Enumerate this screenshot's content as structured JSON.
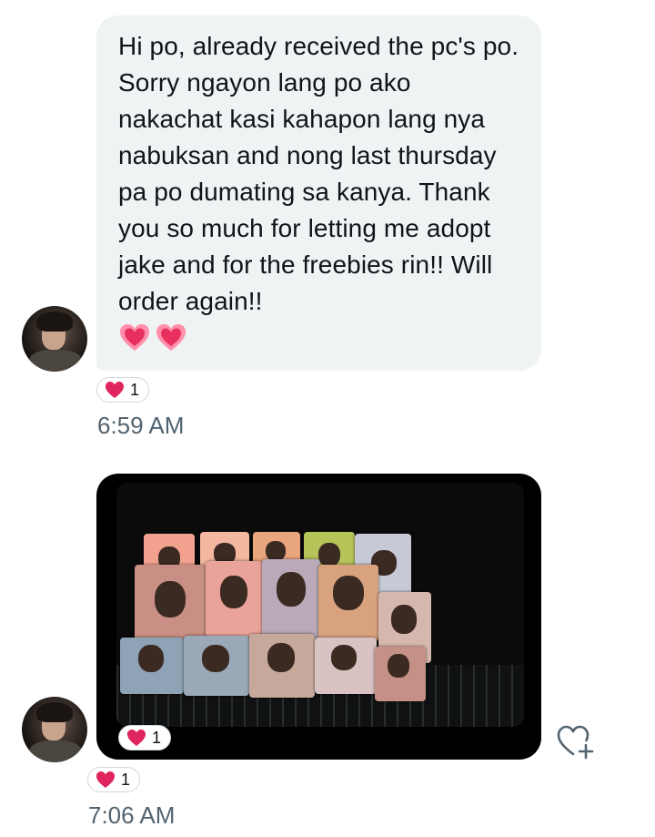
{
  "messages": [
    {
      "text": "Hi po, already received the pc's po. Sorry ngayon lang po ako nakachat kasi kahapon lang nya nabuksan and nong last thursday pa po dumating sa kanya. Thank you so much for letting me adopt jake and for the freebies rin!! Will order again!!",
      "emoji": [
        "pink-heart",
        "pink-heart"
      ],
      "reaction": {
        "icon": "red-heart",
        "count": "1"
      },
      "time": "6:59 AM"
    },
    {
      "media": {
        "type": "photo",
        "subject": "photocards"
      },
      "media_reaction": {
        "icon": "red-heart",
        "count": "1"
      },
      "reaction": {
        "icon": "red-heart",
        "count": "1"
      },
      "time": "7:06 AM"
    }
  ],
  "colors": {
    "bubble": "#eff3f4",
    "heart_red": "#e0245e",
    "heart_pink": "#f06a8f",
    "timestamp": "#536471"
  },
  "icons": {
    "add_reaction": "heart-plus-icon"
  }
}
